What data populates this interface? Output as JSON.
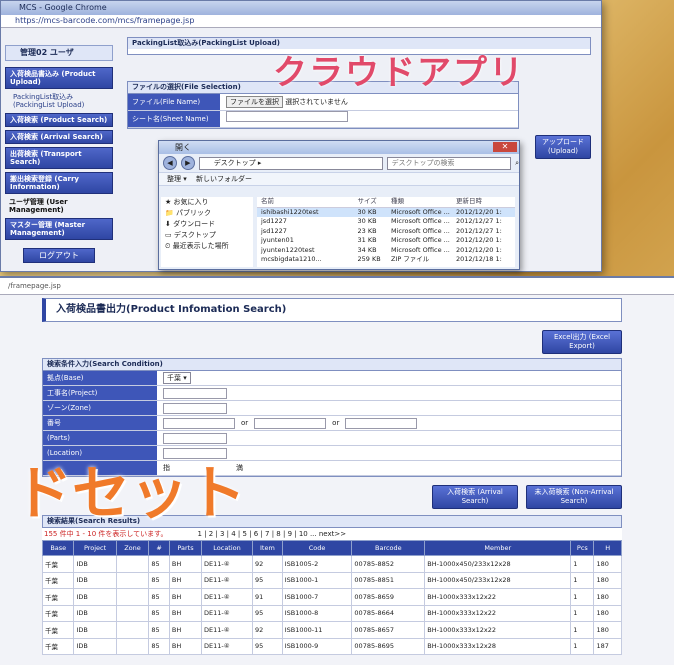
{
  "window1": {
    "title": "MCS - Google Chrome",
    "url": "https://mcs-barcode.com/mcs/framepage.jsp",
    "sidebar": {
      "header": "管理02 ユーザ",
      "items": [
        {
          "label": "入荷検品書込み (Product Upload)",
          "type": "button"
        },
        {
          "label": "PackingList取込み (PackingList Upload)",
          "type": "sub"
        },
        {
          "label": "入荷検索 (Product Search)",
          "type": "button"
        },
        {
          "label": "入荷検索 (Arrival Search)",
          "type": "button"
        },
        {
          "label": "出荷検索 (Transport Search)",
          "type": "button"
        },
        {
          "label": "搬出検索登録 (Carry Information)",
          "type": "button"
        },
        {
          "label": "ユーザ管理 (User Management)",
          "type": "plain"
        },
        {
          "label": "マスター管理 (Master Management)",
          "type": "button"
        }
      ],
      "logout": "ログアウト"
    },
    "upload_panel": {
      "header": "PackingList取込み(PackingList Upload)",
      "file_section": "ファイルの選択(File Selection)",
      "file_label": "ファイル(File Name)",
      "file_button": "ファイルを選択",
      "file_status": "選択されていません",
      "sheet_label": "シート名(Sheet Name)",
      "upload_button": "アップロード (Upload)"
    },
    "overlay": "クラウドアプリ"
  },
  "dialog": {
    "title": "開く",
    "address": "デスクトップ ▸",
    "search_placeholder": "デスクトップの検索",
    "toolbar": "整理 ▾　 新しいフォルダー",
    "favorites": [
      "お気に入り",
      "パブリック",
      "ダウンロード",
      "デスクトップ",
      "最近表示した場所"
    ],
    "columns": [
      "名前",
      "サイズ",
      "種類",
      "更新日時"
    ],
    "files": [
      {
        "name": "ishibashi1220test",
        "size": "30 KB",
        "kind": "Microsoft Office ...",
        "date": "2012/12/20 1:",
        "selected": true
      },
      {
        "name": "jsd1227",
        "size": "30 KB",
        "kind": "Microsoft Office ...",
        "date": "2012/12/27 1:"
      },
      {
        "name": "jsd1227",
        "size": "23 KB",
        "kind": "Microsoft Office ...",
        "date": "2012/12/27 1:"
      },
      {
        "name": "jyunten01",
        "size": "31 KB",
        "kind": "Microsoft Office ...",
        "date": "2012/12/20 1:"
      },
      {
        "name": "jyunten1220test",
        "size": "34 KB",
        "kind": "Microsoft Office ...",
        "date": "2012/12/20 1:"
      },
      {
        "name": "mcsbigdata1210...",
        "size": "259 KB",
        "kind": "ZIP ファイル",
        "date": "2012/12/18 1:"
      }
    ]
  },
  "window2": {
    "url": "/framepage.jsp",
    "title": "入荷検品書出力(Product Infomation Search)",
    "excel_button": "Excel出力 (Excel Export)",
    "condition_header": "検索条件入力(Search Condition)",
    "conditions": [
      {
        "label": "拠点(Base)",
        "value": "千葉"
      },
      {
        "label": "工事名(Project)",
        "value": ""
      },
      {
        "label": "ゾーン(Zone)",
        "value": ""
      },
      {
        "label": "番号",
        "value": ""
      },
      {
        "label": "(Parts)",
        "value": ""
      },
      {
        "label": "(Location)",
        "value": ""
      },
      {
        "label": "",
        "value": ""
      }
    ],
    "range_sep": "or",
    "search_button1": "入荷検索 (Arrival Search)",
    "search_button2": "未入荷検索 (Non-Arrival Search)",
    "results_header": "検索結果(Search Results)",
    "count_text": "155 件中 1 - 10 件を表示しています。",
    "pager": "1 | 2 | 3 | 4 | 5 | 6 | 7 | 8 | 9 | 10 ... next>>",
    "columns": [
      "Base",
      "Project",
      "Zone",
      "#",
      "Parts",
      "Location",
      "Item",
      "Code",
      "Barcode",
      "Member",
      "Pcs",
      "H"
    ],
    "rows": [
      [
        "千葉",
        "IDB",
        "",
        "85",
        "BH",
        "DE11-④",
        "92",
        "ISB1005-2",
        "00785-8852",
        "BH-1000x450/233x12x28",
        "1",
        "180"
      ],
      [
        "千葉",
        "IDB",
        "",
        "85",
        "BH",
        "DE11-④",
        "95",
        "ISB1000-1",
        "00785-8851",
        "BH-1000x450/233x12x28",
        "1",
        "180"
      ],
      [
        "千葉",
        "IDB",
        "",
        "85",
        "BH",
        "DE11-④",
        "91",
        "ISB1000-7",
        "00785-8659",
        "BH-1000x333x12x22",
        "1",
        "180"
      ],
      [
        "千葉",
        "IDB",
        "",
        "85",
        "BH",
        "DE11-④",
        "95",
        "ISB1000-8",
        "00785-8664",
        "BH-1000x333x12x22",
        "1",
        "180"
      ],
      [
        "千葉",
        "IDB",
        "",
        "85",
        "BH",
        "DE11-④",
        "92",
        "ISB1000-11",
        "00785-8657",
        "BH-1000x333x12x22",
        "1",
        "180"
      ],
      [
        "千葉",
        "IDB",
        "",
        "85",
        "BH",
        "DE11-④",
        "95",
        "ISB1000-9",
        "00785-8695",
        "BH-1000x333x12x28",
        "1",
        "187"
      ]
    ],
    "overlay": "ドセット",
    "overlay_fragments": [
      "指",
      "満"
    ]
  }
}
